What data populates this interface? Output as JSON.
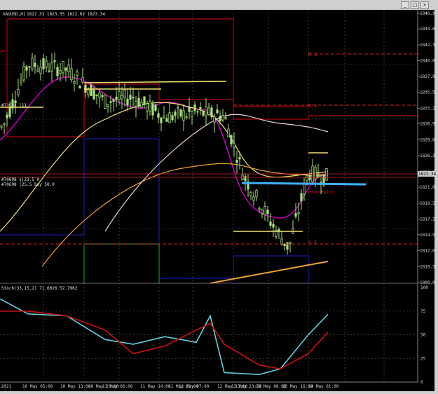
{
  "window": {
    "symbol_title": "XAUUSD,H1",
    "ohlc": "1822.33 1823.55 1822.02 1823.34",
    "buttons": [
      "_",
      "□",
      "×"
    ]
  },
  "price_axis": {
    "ticks": [
      "1846.90",
      "1844.65",
      "1842.35",
      "1840.05",
      "1837.80",
      "1835.50",
      "1833.20",
      "1830.95",
      "1828.65",
      "1826.35",
      "1824.05",
      "1821.80",
      "1819.50",
      "1817.20",
      "1814.95",
      "1812.65",
      "1810.35",
      "1808.05"
    ],
    "current_price": "1823.34"
  },
  "time_axis": {
    "ticks": [
      "7 May 2021",
      "10 May 05:00",
      "10 May 13:00",
      "10 May 21:00",
      "11 May 06:00",
      "11 May 14:00",
      "11 May 22:00",
      "12 May 07:00",
      "12 May 15:00",
      "12 May 23:00",
      "13 May 08:00",
      "13 May 16:00",
      "14 May 01:00"
    ]
  },
  "levels": {
    "r2": "R 2",
    "r1": "R 1",
    "s1": "S 1",
    "pivot_label": "PivotPoint"
  },
  "annotations": {
    "left_upper": "#70698 |11",
    "left_mid_a": "#70698 s|23.5 0",
    "left_mid_b": "#70698 |25.5 buy 50.0"
  },
  "stoch": {
    "label": "Stoch(33,15,2) 71.6026 52.7962",
    "ticks": [
      "100",
      "75",
      "50",
      "25",
      "0"
    ]
  },
  "colors": {
    "up_candle": "#a8e07a",
    "down_candle": "#a8e07a",
    "ma_fast": "#d000d0",
    "ma_mid": "#f0e070",
    "ma_slow": "#f0a030",
    "ma_long": "#f0d0d0",
    "channel_red": "#b00010",
    "channel_blue": "#1a1aa0",
    "channel_green": "#1a8a1a",
    "pivot_blue": "#40b0ff",
    "stoch_main": "#60d0e0",
    "stoch_signal": "#d01010",
    "level_red": "#d22222"
  },
  "chart_data": {
    "type": "line",
    "title": "XAUUSD,H1",
    "ylim": [
      1808.05,
      1846.9
    ],
    "price_series": {
      "name": "close",
      "x": [
        "7 May",
        "10 May 05:00",
        "10 May 13:00",
        "10 May 21:00",
        "11 May 06:00",
        "11 May 14:00",
        "11 May 22:00",
        "12 May 07:00",
        "12 May 15:00",
        "12 May 23:00",
        "13 May 08:00",
        "13 May 16:00",
        "14 May 01:00"
      ],
      "values": [
        1830.5,
        1839.6,
        1838.8,
        1834.2,
        1834.8,
        1831.9,
        1832.6,
        1832.1,
        1823.4,
        1816.2,
        1813.0,
        1823.9,
        1823.3
      ]
    },
    "stoch_series": [
      {
        "name": "main",
        "values": [
          88,
          72,
          70,
          45,
          40,
          48,
          42,
          70,
          10,
          8,
          14,
          50,
          71.6
        ]
      },
      {
        "name": "signal",
        "values": [
          75,
          75,
          70,
          55,
          30,
          38,
          55,
          62,
          40,
          18,
          14,
          30,
          52.8
        ]
      }
    ]
  }
}
